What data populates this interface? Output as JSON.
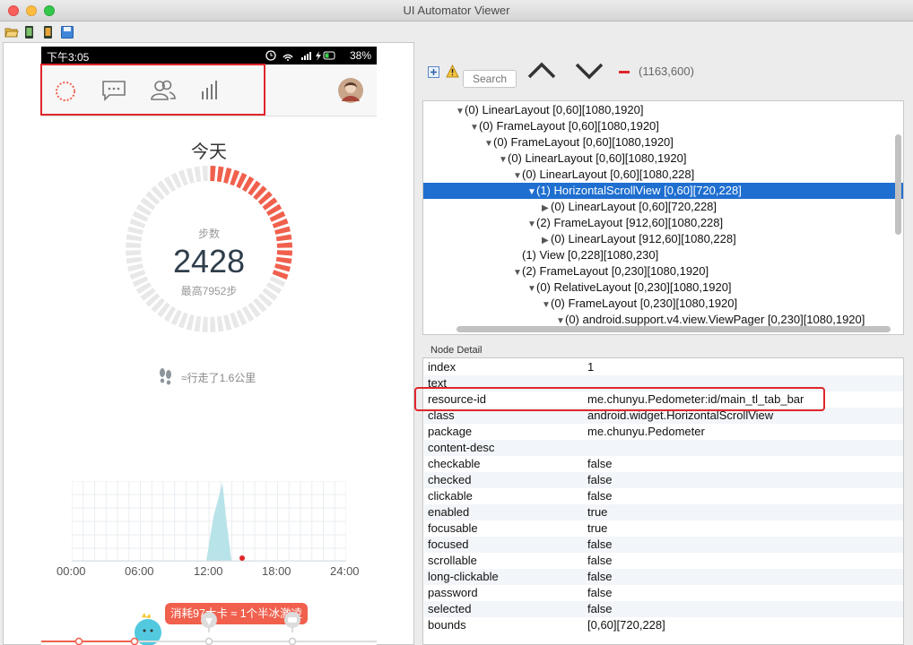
{
  "window": {
    "title": "UI Automator Viewer"
  },
  "phone": {
    "status_time": "下午3:05",
    "battery": "38%",
    "today_label": "今天",
    "steps_label": "步数",
    "steps_value": "2428",
    "steps_max": "最高7952步",
    "step_progress": 0.31,
    "distance": "≈行走了1.6公里",
    "chart_times": [
      "00:00",
      "06:00",
      "12:00",
      "18:00",
      "24:00"
    ],
    "tooltip": "消耗97大卡 ≈ 1个半冰激凌"
  },
  "tree_toolbar": {
    "search_placeholder": "Search",
    "coords": "(1163,600)"
  },
  "tree": [
    {
      "indent": 0,
      "arrow": "▼",
      "text": "(0) LinearLayout [0,60][1080,1920]",
      "selected": false
    },
    {
      "indent": 1,
      "arrow": "▼",
      "text": "(0) FrameLayout [0,60][1080,1920]",
      "selected": false
    },
    {
      "indent": 2,
      "arrow": "▼",
      "text": "(0) FrameLayout [0,60][1080,1920]",
      "selected": false
    },
    {
      "indent": 3,
      "arrow": "▼",
      "text": "(0) LinearLayout [0,60][1080,1920]",
      "selected": false
    },
    {
      "indent": 4,
      "arrow": "▼",
      "text": "(0) LinearLayout [0,60][1080,228]",
      "selected": false
    },
    {
      "indent": 5,
      "arrow": "▼",
      "text": "(1) HorizontalScrollView [0,60][720,228]",
      "selected": true
    },
    {
      "indent": 6,
      "arrow": "▶",
      "text": "(0) LinearLayout [0,60][720,228]",
      "selected": false
    },
    {
      "indent": 5,
      "arrow": "▼",
      "text": "(2) FrameLayout [912,60][1080,228]",
      "selected": false
    },
    {
      "indent": 6,
      "arrow": "▶",
      "text": "(0) LinearLayout [912,60][1080,228]",
      "selected": false
    },
    {
      "indent": 4,
      "arrow": "",
      "text": "(1) View [0,228][1080,230]",
      "selected": false
    },
    {
      "indent": 4,
      "arrow": "▼",
      "text": "(2) FrameLayout [0,230][1080,1920]",
      "selected": false
    },
    {
      "indent": 5,
      "arrow": "▼",
      "text": "(0) RelativeLayout [0,230][1080,1920]",
      "selected": false
    },
    {
      "indent": 6,
      "arrow": "▼",
      "text": "(0) FrameLayout [0,230][1080,1920]",
      "selected": false
    },
    {
      "indent": 7,
      "arrow": "▼",
      "text": "(0) android.support.v4.view.ViewPager [0,230][1080,1920]",
      "selected": false
    }
  ],
  "node_detail": {
    "title": "Node Detail",
    "rows": [
      {
        "key": "index",
        "value": "1"
      },
      {
        "key": "text",
        "value": ""
      },
      {
        "key": "resource-id",
        "value": "me.chunyu.Pedometer:id/main_tl_tab_bar"
      },
      {
        "key": "class",
        "value": "android.widget.HorizontalScrollView"
      },
      {
        "key": "package",
        "value": "me.chunyu.Pedometer"
      },
      {
        "key": "content-desc",
        "value": ""
      },
      {
        "key": "checkable",
        "value": "false"
      },
      {
        "key": "checked",
        "value": "false"
      },
      {
        "key": "clickable",
        "value": "false"
      },
      {
        "key": "enabled",
        "value": "true"
      },
      {
        "key": "focusable",
        "value": "true"
      },
      {
        "key": "focused",
        "value": "false"
      },
      {
        "key": "scrollable",
        "value": "false"
      },
      {
        "key": "long-clickable",
        "value": "false"
      },
      {
        "key": "password",
        "value": "false"
      },
      {
        "key": "selected",
        "value": "false"
      },
      {
        "key": "bounds",
        "value": "[0,60][720,228]"
      }
    ]
  },
  "colors": {
    "accent": "#f0604d",
    "selection": "#1f6fd0",
    "highlight_box": "#e0262b",
    "chart_fill": "#b8e3e8"
  }
}
